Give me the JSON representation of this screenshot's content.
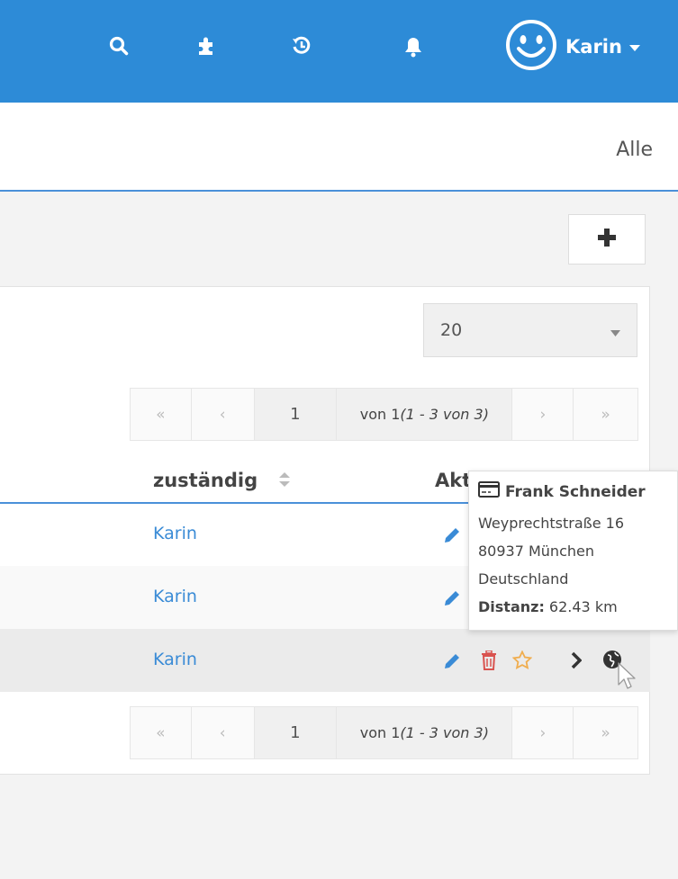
{
  "topbar": {
    "user_name": "Karin",
    "icons": [
      "search-icon",
      "puzzle-icon",
      "history-icon",
      "bell-icon",
      "smiley-avatar-icon",
      "caret-down-icon"
    ]
  },
  "header": {
    "filter_label": "Alle"
  },
  "per_page": {
    "value": "20"
  },
  "pagination": {
    "first": "«",
    "prev": "‹",
    "page": "1",
    "info_prefix": "von 1 ",
    "info_range": "(1 - 3 von 3)",
    "next": "›",
    "last": "»"
  },
  "table": {
    "columns": [
      "zuständig",
      "Akt"
    ],
    "rows": [
      {
        "assignee": "Karin"
      },
      {
        "assignee": "Karin"
      },
      {
        "assignee": "Karin"
      }
    ]
  },
  "tooltip": {
    "name": "Frank Schneider",
    "street": "Weyprechtstraße 16",
    "city": "80937 München",
    "country": "Deutschland",
    "distance_label": "Distanz:",
    "distance_value": " 62.43 km"
  },
  "colors": {
    "topbar": "#2d8bd7",
    "link": "#3a8bd6",
    "delete": "#d9534f",
    "star": "#f0ad4e"
  }
}
